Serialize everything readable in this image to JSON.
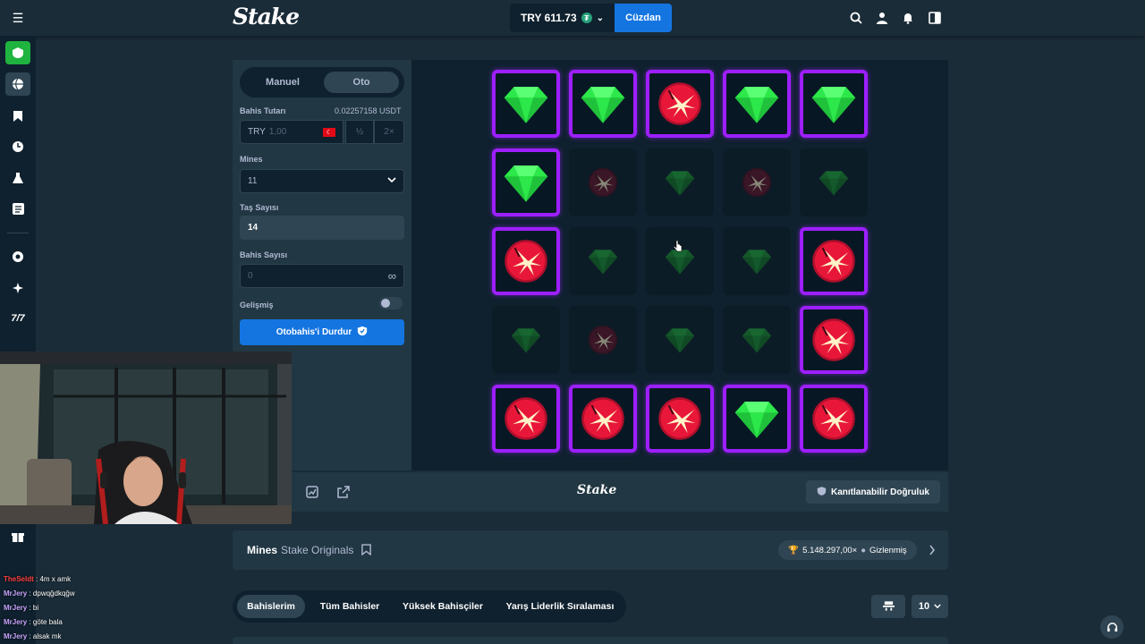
{
  "header": {
    "logo": "Stake",
    "balance": "TRY 611.73",
    "currency_icon": "tether-icon",
    "wallet_button": "Cüzdan"
  },
  "panel": {
    "tabs": [
      "Manuel",
      "Oto"
    ],
    "active_tab": "Oto",
    "bet_amount_label": "Bahis Tutarı",
    "bet_amount_usdt": "0.02257158 USDT",
    "bet_currency": "TRY",
    "bet_placeholder": "1,00",
    "half_button": "½",
    "double_button": "2×",
    "mines_label": "Mines",
    "mines_value": "11",
    "gems_label": "Taş Sayısı",
    "gems_value": "14",
    "bets_label": "Bahis Sayısı",
    "bets_value": "0",
    "advanced_label": "Gelişmiş",
    "stop_button": "Otobahis'i Durdur"
  },
  "board": {
    "rows": [
      [
        {
          "t": "gem",
          "r": true
        },
        {
          "t": "gem",
          "r": true
        },
        {
          "t": "mine",
          "r": true
        },
        {
          "t": "gem",
          "r": true
        },
        {
          "t": "gem",
          "r": true
        }
      ],
      [
        {
          "t": "gem",
          "r": true
        },
        {
          "t": "mine",
          "r": false
        },
        {
          "t": "gem",
          "r": false
        },
        {
          "t": "mine",
          "r": false
        },
        {
          "t": "gem",
          "r": false
        }
      ],
      [
        {
          "t": "mine",
          "r": true
        },
        {
          "t": "gem",
          "r": false
        },
        {
          "t": "gem",
          "r": false
        },
        {
          "t": "gem",
          "r": false
        },
        {
          "t": "mine",
          "r": true
        }
      ],
      [
        {
          "t": "gem",
          "r": false
        },
        {
          "t": "mine",
          "r": false
        },
        {
          "t": "gem",
          "r": false
        },
        {
          "t": "gem",
          "r": false
        },
        {
          "t": "mine",
          "r": true
        }
      ],
      [
        {
          "t": "mine",
          "r": true
        },
        {
          "t": "mine",
          "r": true
        },
        {
          "t": "mine",
          "r": true
        },
        {
          "t": "gem",
          "r": true
        },
        {
          "t": "mine",
          "r": true
        }
      ]
    ]
  },
  "toolbar": {
    "brand": "Stake",
    "fairness_button": "Kanıtlanabilir Doğruluk"
  },
  "info": {
    "game_name": "Mines",
    "game_provider": "Stake Originals",
    "max_win": "5.148.297,00×",
    "hidden_label": "Gizlenmiş"
  },
  "bets": {
    "tabs": [
      "Bahislerim",
      "Tüm Bahisler",
      "Yüksek Bahisçiler",
      "Yarış Liderlik Sıralaması"
    ],
    "active_tab": "Bahislerim",
    "page_size": "10"
  },
  "chat": [
    {
      "user": "TheSeldt",
      "msg": "4m x amk"
    },
    {
      "user": "MrJery",
      "msg": "dpwqğdkqğw"
    },
    {
      "user": "MrJery",
      "msg": "bi"
    },
    {
      "user": "MrJery",
      "msg": "göte bala"
    },
    {
      "user": "MrJery",
      "msg": "alsak mk"
    }
  ],
  "colors": {
    "accent_blue": "#1475e1",
    "reveal_border": "#9d1fff",
    "gem_green": "#2ce84a",
    "mine_red": "#e8173a"
  }
}
